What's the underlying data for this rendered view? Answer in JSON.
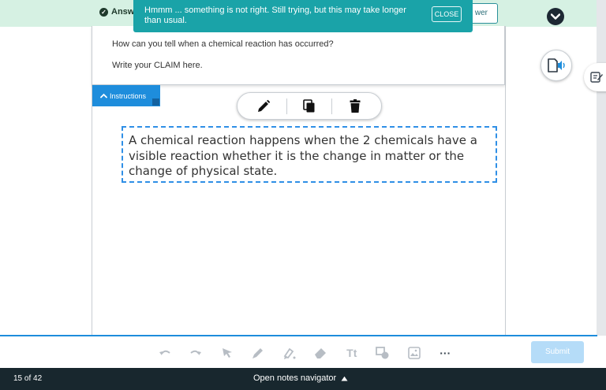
{
  "header": {
    "answered_label": "Answ",
    "answer_button_label": "wer"
  },
  "toast": {
    "message": "Hmmm ... something is not right. Still trying, but this may take longer than usual.",
    "close_label": "CLOSE"
  },
  "prompt": {
    "question": "How can you tell when a chemical reaction has occurred?",
    "claim_instruction": "Write your CLAIM here."
  },
  "instructions_tab": {
    "label": "Instructions",
    "icon": "chevron-up-icon"
  },
  "floating_toolbar": {
    "icons": [
      "pencil-icon",
      "copy-icon",
      "trash-icon"
    ]
  },
  "text_box": {
    "content": "A chemical reaction happens when the 2 chemicals have a visible reaction whether it is the change in matter or the change of physical state."
  },
  "side_buttons": {
    "audio_icon": "read-aloud-icon",
    "notes_icon": "notes-edit-icon"
  },
  "drawing_toolbar": {
    "icons": [
      "undo-icon",
      "redo-icon",
      "select-arrow-icon",
      "pen-icon",
      "highlighter-icon",
      "eraser-icon",
      "text-tool-icon",
      "shapes-icon",
      "image-icon",
      "more-icon"
    ],
    "text_tool_label": "Tt",
    "more_label": "···",
    "submit_label": "Submit"
  },
  "footer": {
    "page_count": "15 of 42",
    "notes_navigator_label": "Open notes navigator"
  },
  "colors": {
    "accent_blue": "#1e8ddc",
    "toast_teal": "#1aa3a8",
    "header_green": "#d6f1e3",
    "footer_dark": "#18272e",
    "submit_disabled": "#b5dcf8"
  }
}
